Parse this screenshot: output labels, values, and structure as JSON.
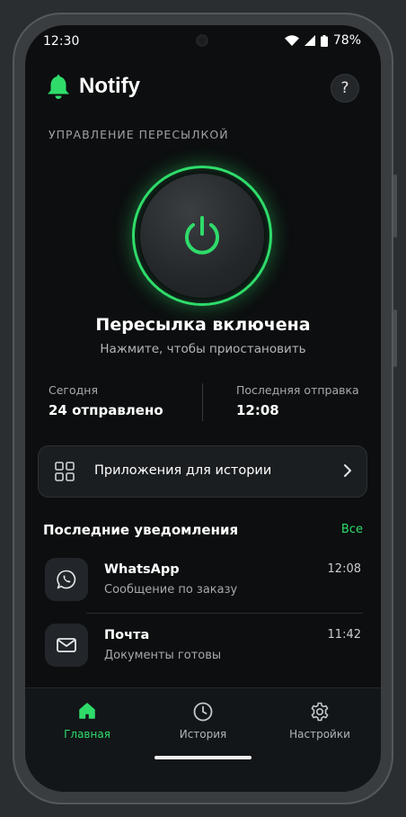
{
  "status_bar": {
    "time": "12:30",
    "battery": "78%"
  },
  "header": {
    "app_title": "Notify",
    "help_label": "?"
  },
  "forwarding": {
    "section_label": "УПРАВЛЕНИЕ ПЕРЕСЫЛКОЙ",
    "status_title": "Пересылка включена",
    "status_hint": "Нажмите, чтобы приостановить",
    "enabled": true
  },
  "stats": {
    "today_label": "Сегодня",
    "today_value": "24 отправлено",
    "last_label": "Последняя отправка",
    "last_value": "12:08"
  },
  "apps_card": {
    "label": "Приложения для истории"
  },
  "recent": {
    "title": "Последние уведомления",
    "all_link": "Все",
    "items": [
      {
        "app": "WhatsApp",
        "message": "Сообщение по заказу",
        "time": "12:08",
        "icon": "whatsapp-icon"
      },
      {
        "app": "Почта",
        "message": "Документы готовы",
        "time": "11:42",
        "icon": "mail-icon"
      }
    ]
  },
  "nav": {
    "items": [
      {
        "label": "Главная",
        "icon": "home-icon",
        "active": true
      },
      {
        "label": "История",
        "icon": "clock-icon",
        "active": false
      },
      {
        "label": "Настройки",
        "icon": "gear-icon",
        "active": false
      }
    ]
  },
  "colors": {
    "accent": "#2fdc6a",
    "background": "#0c0e0f",
    "card": "#1b1e20"
  }
}
